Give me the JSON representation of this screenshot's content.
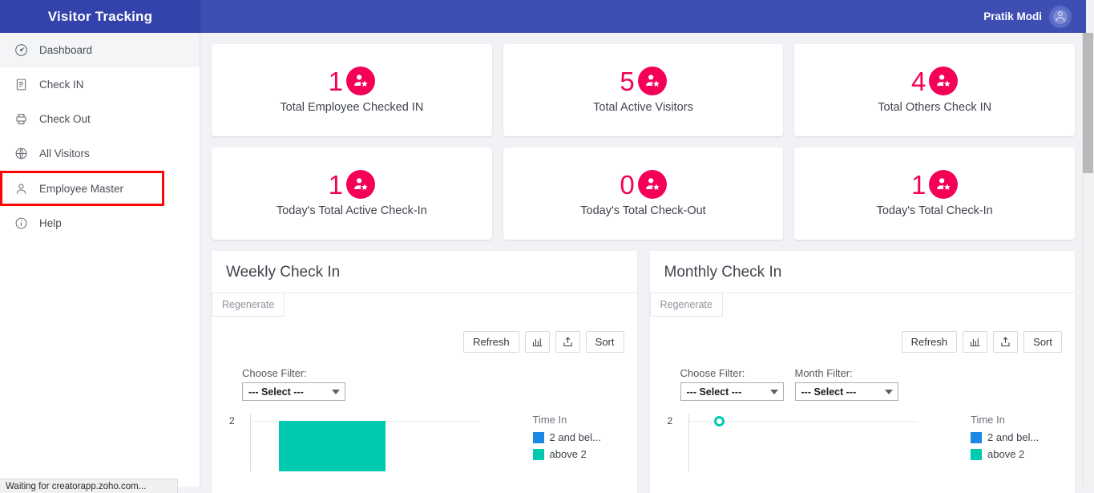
{
  "app": {
    "brand_title": "Visitor Tracking",
    "user_name": "Pratik Modi",
    "avatar_icon": "user-avatar-icon",
    "accent_blue": "#3e4eb2",
    "brand_blue": "#3442ab",
    "accent_pink": "#f50057",
    "accent_teal": "#00c9b1",
    "accent_legend_blue": "#1e88e5",
    "highlight_red": "#fb0606"
  },
  "sidebar": {
    "items": [
      {
        "label": "Dashboard",
        "icon": "speedometer-icon",
        "active": true,
        "highlight": false
      },
      {
        "label": "Check IN",
        "icon": "form-list-icon",
        "active": false,
        "highlight": false
      },
      {
        "label": "Check Out",
        "icon": "printer-icon",
        "active": false,
        "highlight": false
      },
      {
        "label": "All Visitors",
        "icon": "globe-icon",
        "active": false,
        "highlight": false
      },
      {
        "label": "Employee Master",
        "icon": "person-icon",
        "active": false,
        "highlight": true
      },
      {
        "label": "Help",
        "icon": "info-circle-icon",
        "active": false,
        "highlight": false
      }
    ]
  },
  "stats": {
    "row1": [
      {
        "value": "1",
        "label": "Total Employee Checked IN",
        "icon": "user-star-icon"
      },
      {
        "value": "5",
        "label": "Total Active Visitors",
        "icon": "user-star-icon"
      },
      {
        "value": "4",
        "label": "Total Others Check IN",
        "icon": "user-star-icon"
      }
    ],
    "row2": [
      {
        "value": "1",
        "label": "Today's Total Active Check-In",
        "icon": "user-star-icon"
      },
      {
        "value": "0",
        "label": "Today's Total Check-Out",
        "icon": "user-star-icon"
      },
      {
        "value": "1",
        "label": "Today's Total Check-In",
        "icon": "user-star-icon"
      }
    ]
  },
  "panels": [
    {
      "title": "Weekly Check In",
      "regenerate_label": "Regenerate",
      "toolbar": {
        "refresh_label": "Refresh",
        "chart_icon": "bar-chart-icon",
        "export_icon": "export-upload-icon",
        "sort_label": "Sort"
      },
      "filters": [
        {
          "label": "Choose Filter:",
          "value": "--- Select ---"
        }
      ],
      "legend_title": "Time In",
      "legend": [
        {
          "label": "2 and bel...",
          "color": "#1e88e5"
        },
        {
          "label": "above 2",
          "color": "#00c9b1"
        }
      ]
    },
    {
      "title": "Monthly Check In",
      "regenerate_label": "Regenerate",
      "toolbar": {
        "refresh_label": "Refresh",
        "chart_icon": "bar-chart-icon",
        "export_icon": "export-upload-icon",
        "sort_label": "Sort"
      },
      "filters": [
        {
          "label": "Choose Filter:",
          "value": "--- Select ---"
        },
        {
          "label": "Month Filter:",
          "value": "--- Select ---"
        }
      ],
      "legend_title": "Time In",
      "legend": [
        {
          "label": "2 and bel...",
          "color": "#1e88e5"
        },
        {
          "label": "above 2",
          "color": "#00c9b1"
        }
      ]
    }
  ],
  "chart_data": [
    {
      "type": "bar",
      "title": "Weekly Check In",
      "categories": [
        ""
      ],
      "series": [
        {
          "name": "2 and bel...",
          "values": [
            0
          ]
        },
        {
          "name": "above 2",
          "values": [
            2
          ]
        }
      ],
      "ytick_labels": [
        "2"
      ],
      "ylim": [
        0,
        2
      ],
      "xlabel": "",
      "ylabel": "",
      "grid": true,
      "legend_title": "Time In",
      "legend_position": "right"
    },
    {
      "type": "scatter",
      "title": "Monthly Check In",
      "categories": [
        ""
      ],
      "series": [
        {
          "name": "2 and bel...",
          "values": [
            0
          ]
        },
        {
          "name": "above 2",
          "values": [
            2
          ]
        }
      ],
      "ytick_labels": [
        "2"
      ],
      "ylim": [
        0,
        2
      ],
      "xlabel": "",
      "ylabel": "",
      "grid": true,
      "legend_title": "Time In",
      "legend_position": "right"
    }
  ],
  "statusbar": {
    "text": "Waiting for creatorapp.zoho.com..."
  }
}
